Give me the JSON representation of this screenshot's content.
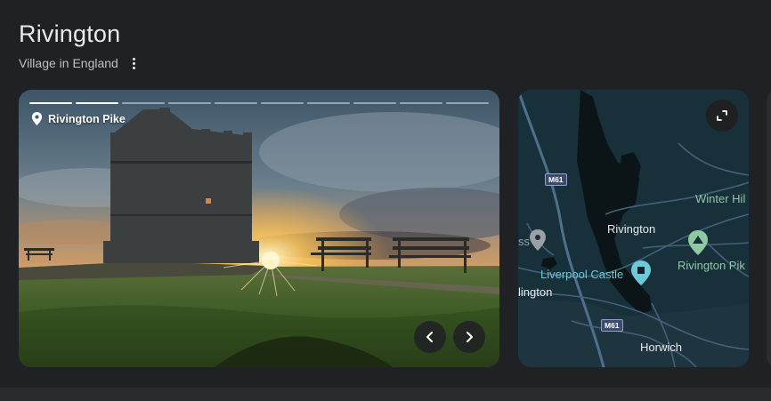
{
  "header": {
    "title": "Rivington",
    "subtitle": "Village in England",
    "more_icon": "more-vertical-icon"
  },
  "photo": {
    "location_label": "Rivington Pike",
    "location_icon": "location-pin-icon",
    "slide_count": 10,
    "active_slide": 2,
    "prev_icon": "chevron-left-icon",
    "next_icon": "chevron-right-icon"
  },
  "map": {
    "expand_icon": "expand-icon",
    "labels": {
      "winter_hill": "Winter Hil",
      "rivington": "Rivington",
      "rivington_pike": "Rivington Pik",
      "liverpool_castle": "Liverpool Castle",
      "ss_fragment": "ss",
      "lington": "lington",
      "horwich": "Horwich"
    },
    "road_badges": {
      "upper": "M61",
      "lower": "M61"
    },
    "colors": {
      "land": "#17303a",
      "water": "#0b1416",
      "roads": "#4f6f8f",
      "poi": "#8fc9a4",
      "castle": "#6fc8d6"
    }
  }
}
